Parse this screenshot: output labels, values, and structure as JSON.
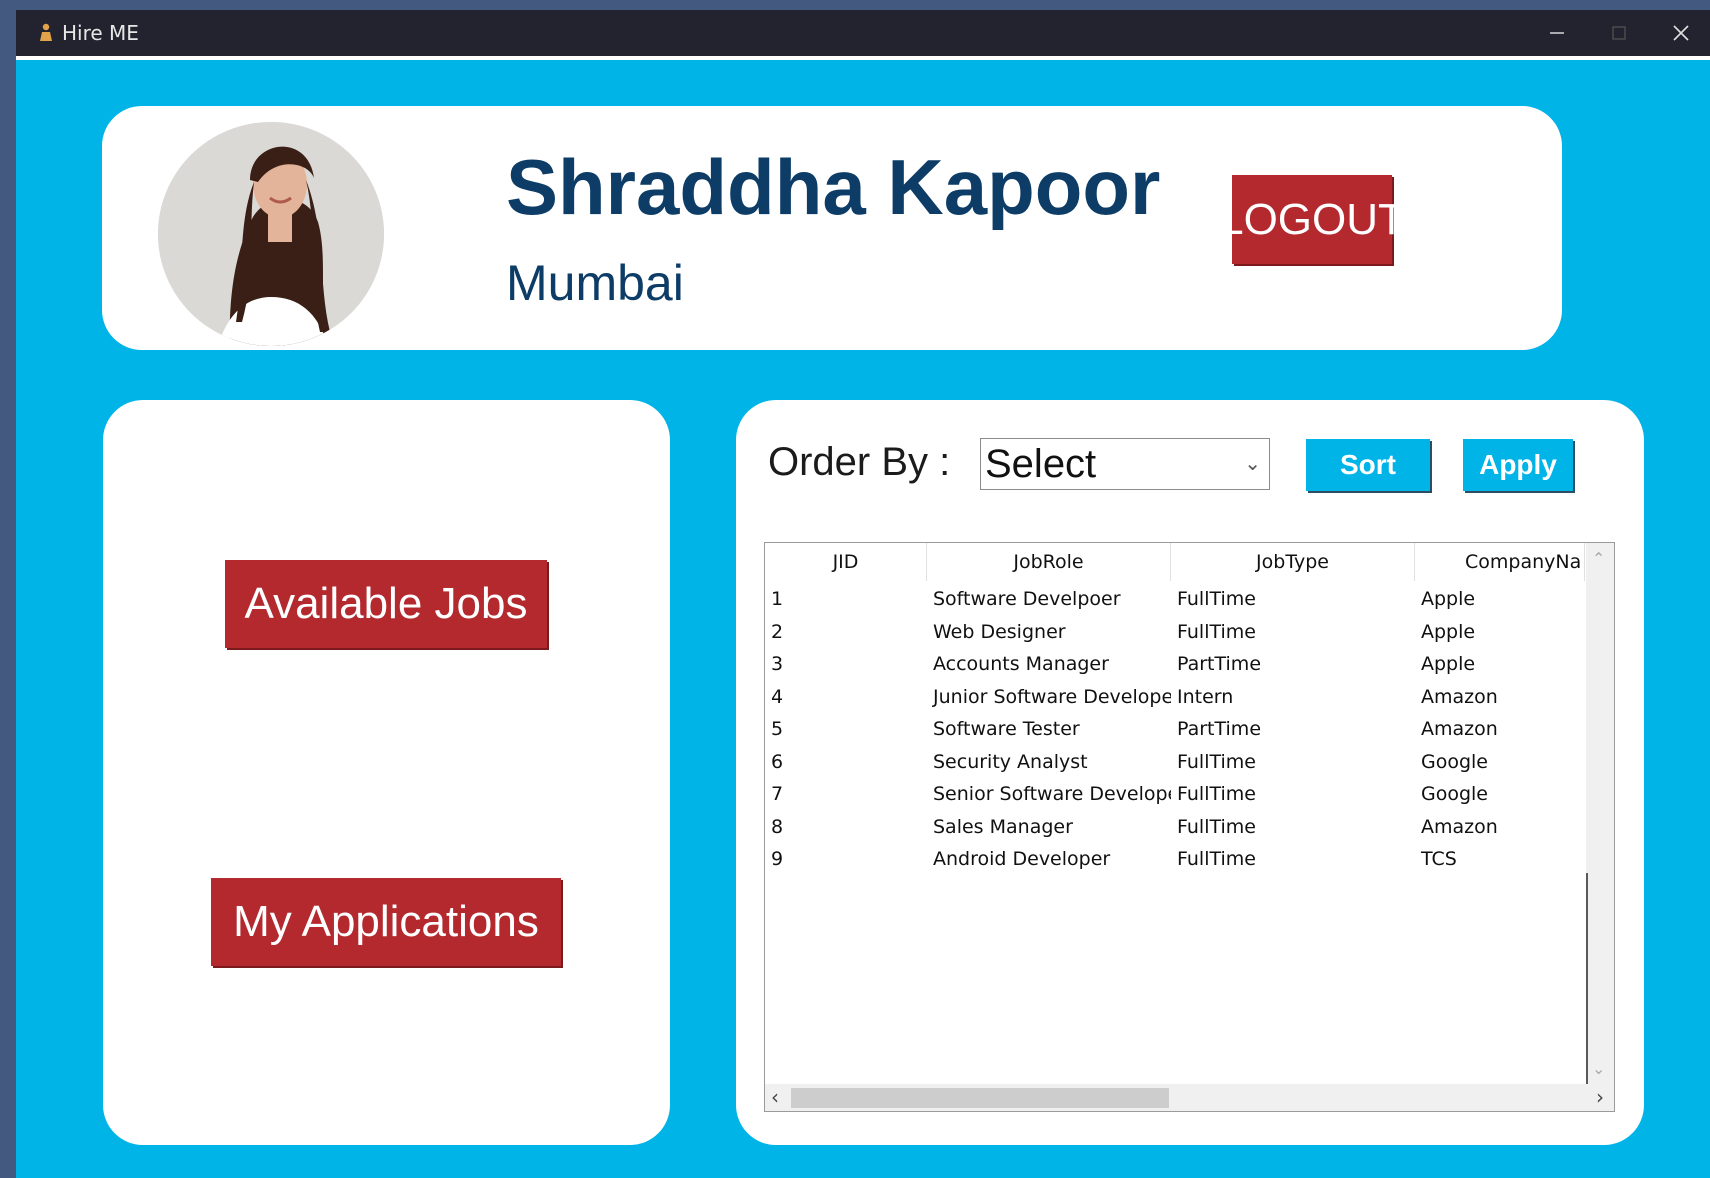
{
  "window": {
    "title": "Hire ME",
    "icon": "person-icon"
  },
  "profile": {
    "name": "Shraddha Kapoor",
    "city": "Mumbai",
    "logout_label": "LOGOUT"
  },
  "nav": {
    "available_jobs_label": "Available Jobs",
    "my_applications_label": "My Applications"
  },
  "order": {
    "label": "Order By :",
    "selected": "Select",
    "sort_label": "Sort",
    "apply_label": "Apply"
  },
  "table": {
    "columns": [
      "JID",
      "JobRole",
      "JobType",
      "CompanyNa"
    ],
    "rows": [
      [
        "1",
        "Software Develpoer",
        "FullTime",
        "Apple"
      ],
      [
        "2",
        "Web Designer",
        "FullTime",
        "Apple"
      ],
      [
        "3",
        "Accounts Manager",
        "PartTime",
        "Apple"
      ],
      [
        "4",
        "Junior Software Developer",
        "Intern",
        "Amazon"
      ],
      [
        "5",
        "Software Tester",
        "PartTime",
        "Amazon"
      ],
      [
        "6",
        "Security Analyst",
        "FullTime",
        "Google"
      ],
      [
        "7",
        "Senior Software Developer",
        "FullTime",
        "Google"
      ],
      [
        "8",
        "Sales Manager",
        "FullTime",
        "Amazon"
      ],
      [
        "9",
        "Android Developer",
        "FullTime",
        "TCS"
      ]
    ]
  },
  "colors": {
    "background": "#00b4e8",
    "titlebar": "#22232e",
    "accent_red": "#b3292e",
    "name_text": "#0d3d67"
  }
}
